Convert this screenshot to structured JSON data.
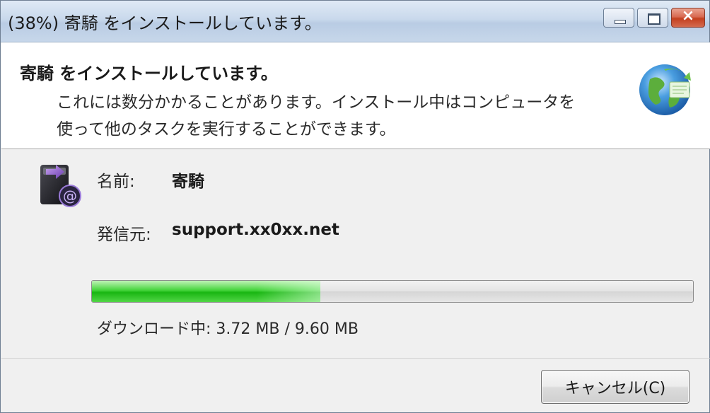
{
  "window": {
    "title": "(38%) 寄騎 をインストールしています。",
    "caption_buttons": [
      "minimize",
      "maximize",
      "close"
    ]
  },
  "header": {
    "title": "寄騎 をインストールしています。",
    "description_line1": "これには数分かかることがあります。インストール中はコンピュータを",
    "description_line2": "使って他のタスクを実行することができます。",
    "icon": "globe-arrows-icon"
  },
  "details": {
    "app_icon": "app-install-icon",
    "name_label": "名前:",
    "name_value": "寄騎",
    "publisher_label": "発信元:",
    "publisher_value": "support.xx0xx.net"
  },
  "progress": {
    "percent": 38,
    "status": "ダウンロード中: 3.72 MB / 9.60 MB"
  },
  "footer": {
    "cancel_label": "キャンセル(C)"
  },
  "colors": {
    "progress_green": "#22b818",
    "titlebar": "#c9d9ec",
    "close_red": "#c4401f"
  }
}
